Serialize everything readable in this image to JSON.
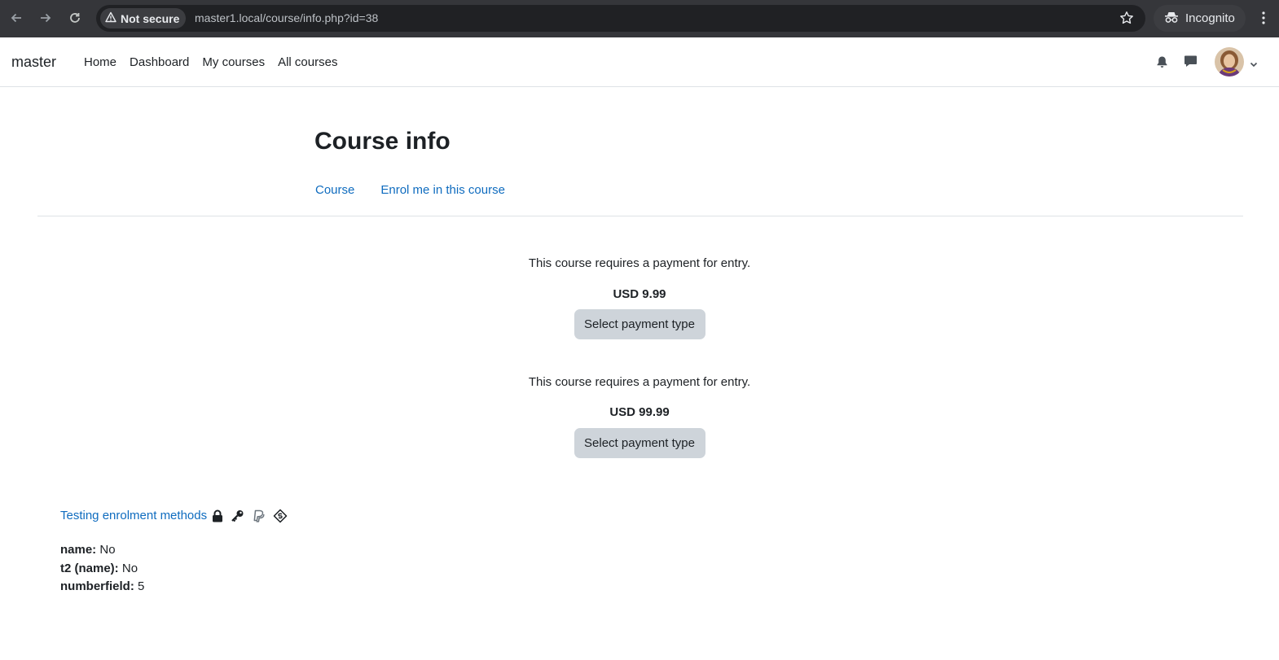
{
  "browser": {
    "security_label": "Not secure",
    "url": "master1.local/course/info.php?id=38",
    "profile_label": "Incognito",
    "icons": [
      "back-arrow-icon",
      "forward-arrow-icon",
      "reload-icon",
      "warning-icon",
      "star-icon",
      "incognito-icon",
      "kebab-menu-icon"
    ]
  },
  "navbar": {
    "brand": "master",
    "items": [
      {
        "label": "Home"
      },
      {
        "label": "Dashboard"
      },
      {
        "label": "My courses"
      },
      {
        "label": "All courses"
      }
    ],
    "icons": [
      "bell-icon",
      "message-icon",
      "chevron-down-icon"
    ]
  },
  "page": {
    "title": "Course info",
    "secondary_nav": [
      {
        "label": "Course"
      },
      {
        "label": "Enrol me in this course"
      }
    ]
  },
  "payments": [
    {
      "text": "This course requires a payment for entry.",
      "cost": "USD 9.99",
      "button": "Select payment type"
    },
    {
      "text": "This course requires a payment for entry.",
      "cost": "USD 99.99",
      "button": "Select payment type"
    }
  ],
  "course": {
    "name": "Testing enrolment methods",
    "enrol_icons": [
      "lock-icon",
      "key-icon",
      "paypal-icon",
      "payment-ticket-icon"
    ],
    "fields": [
      {
        "label": "name:",
        "value": "No"
      },
      {
        "label": "t2 (name):",
        "value": "No"
      },
      {
        "label": "numberfield:",
        "value": "5"
      }
    ]
  },
  "colors": {
    "link": "#0f6cbf",
    "chrome_bg": "#35363a",
    "button_bg": "#ced4da"
  }
}
